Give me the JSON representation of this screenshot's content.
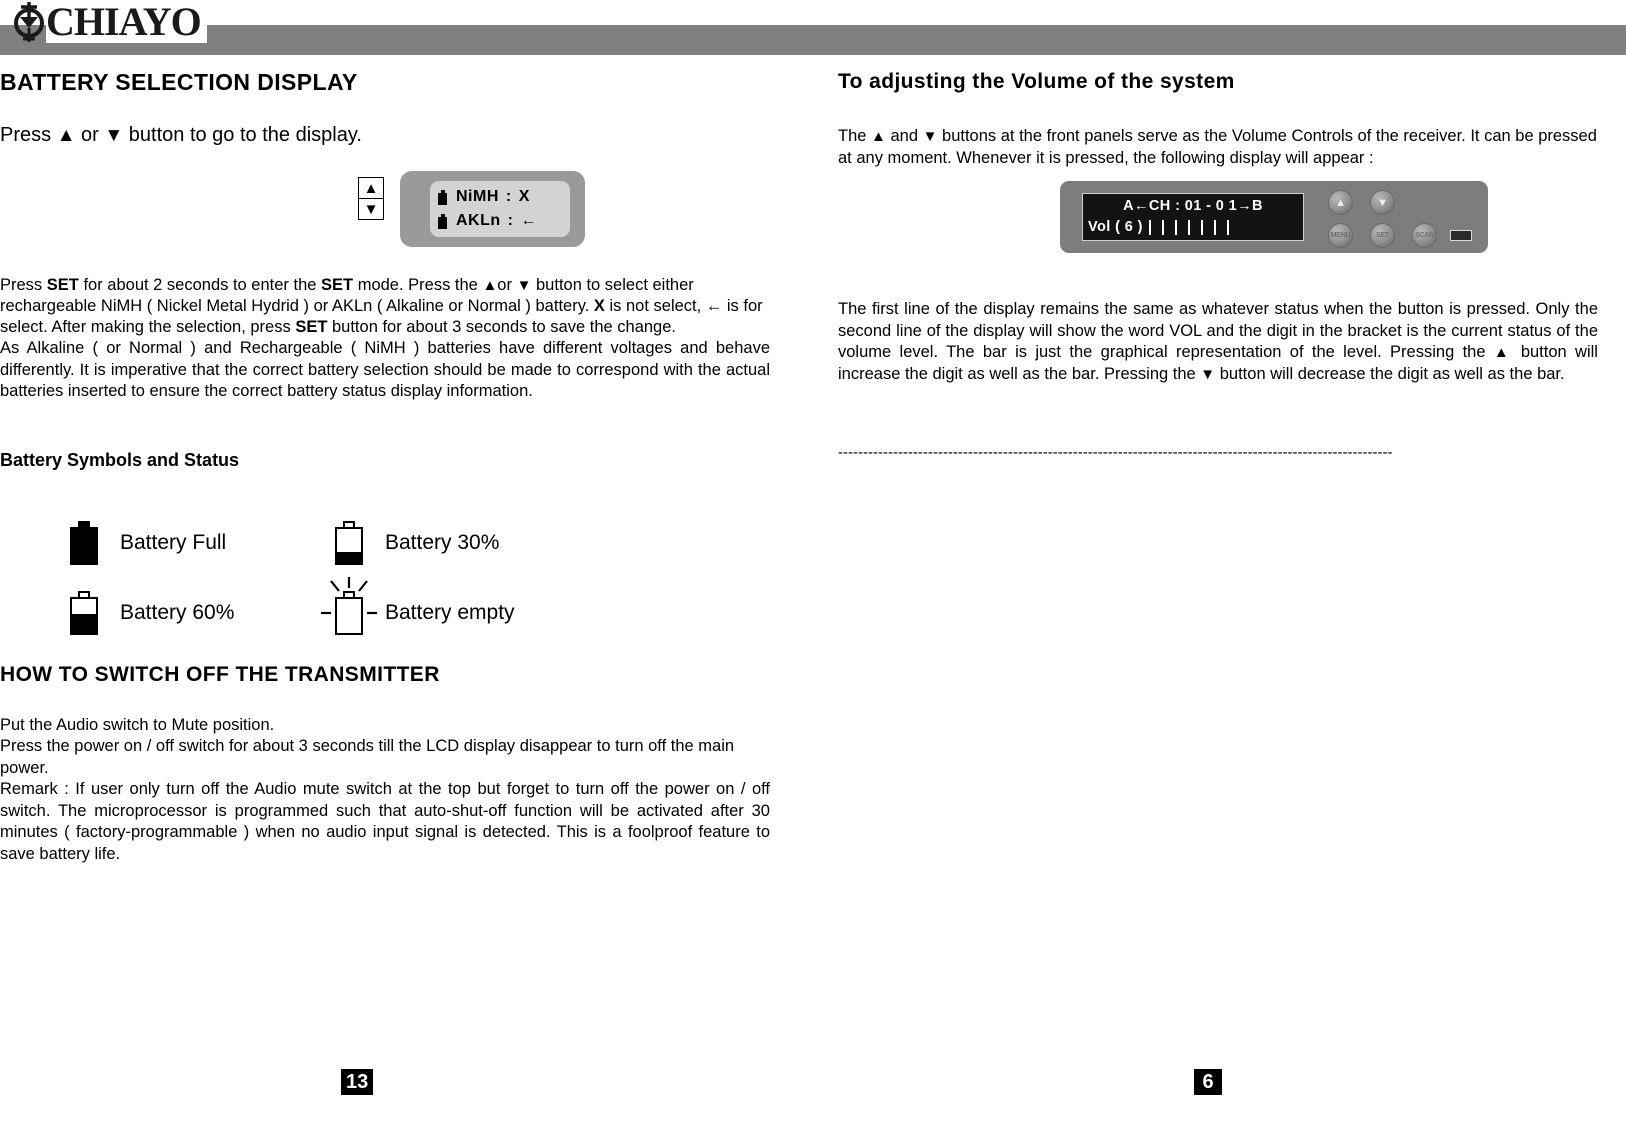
{
  "brand": {
    "name": "CHIAYO",
    "logo_icon": "chiayo-emblem-icon"
  },
  "left_column": {
    "title": "BATTERY SELECTION DISPLAY",
    "intro_pre": "Press ",
    "intro_mid": " or ",
    "intro_post": " button to go to the display.",
    "lcd": {
      "line1_label": "NiMH",
      "line1_sep": ":",
      "line1_value": "X",
      "line2_label": "AKLn",
      "line2_sep": ":",
      "line2_value": "←",
      "up_key": "▲",
      "down_key": "▼"
    },
    "para1": {
      "s1": "Press ",
      "b1": "SET",
      "s2": " for about 2 seconds to enter the ",
      "b2": "SET",
      "s3": " mode. Press the ",
      "s4": "or ",
      "s5": " button to select either rechargeable NiMH ( Nickel Metal Hydrid ) or AKLn ( Alkaline or Normal ) battery.  ",
      "b3": "X",
      "s6": " is not select, ← is for select. After making the selection, press ",
      "b4": "SET",
      "s7": " button for about 3 seconds to save the change."
    },
    "para2": "As Alkaline ( or Normal ) and Rechargeable ( NiMH ) batteries have different voltages and behave differently. It is imperative that the correct battery selection should be made to correspond with the actual batteries inserted to ensure the correct battery status display information.",
    "legend_title": "Battery Symbols and Status",
    "legend": [
      {
        "icon": "battery-full-icon",
        "label": "Battery Full",
        "fill_percent": 100
      },
      {
        "icon": "battery-30-icon",
        "label": "Battery 30%",
        "fill_percent": 30
      },
      {
        "icon": "battery-60-icon",
        "label": "Battery 60%",
        "fill_percent": 60
      },
      {
        "icon": "battery-empty-icon",
        "label": "Battery empty",
        "fill_percent": 0
      }
    ],
    "switch_off_title": "HOW TO SWITCH OFF THE TRANSMITTER",
    "switch_off_line1": "Put the Audio switch to Mute position.",
    "switch_off_line2": "Press the power on / off switch for about 3 seconds till the LCD display disappear to turn off the main power.",
    "switch_off_line3": "Remark : If user only turn off the Audio mute switch at the top but forget to turn off the power on / off switch. The microprocessor is programmed such that auto-shut-off function will be activated after 30 minutes ( factory-programmable ) when no audio input signal is detected. This is a foolproof feature to save battery life.",
    "page_number": "13"
  },
  "right_column": {
    "title": "To adjusting the Volume of the system",
    "para1": {
      "s1": "The ",
      "s2": " and ",
      "s3": " buttons at the front panels serve as the Volume Controls of the receiver. It can be pressed at any moment. Whenever it is pressed, the following display will appear :"
    },
    "panel": {
      "lcd_line1": "A←CH : 01 - 0 1→B",
      "lcd_line2_label": "Vol ( 6 )",
      "vol_bar_count": 7,
      "buttons": [
        {
          "name": "panel-up-button",
          "label": "▲"
        },
        {
          "name": "panel-down-button",
          "label": "▼"
        },
        {
          "name": "panel-menu-button",
          "label": "MENU"
        },
        {
          "name": "panel-set-button",
          "label": "SET"
        },
        {
          "name": "panel-scan-button",
          "label": "SCAN"
        }
      ],
      "led_indicator": "power-led-indicator"
    },
    "para2": {
      "s1": "The first line of the display remains the same as whatever status when the button is pressed. Only the second line of the display will show the word VOL and the digit in the bracket is the current status of the volume level. The bar is just the graphical representation of the level. Pressing the ",
      "s2": " button will increase the digit as well as the bar. Pressing the ",
      "s3": " button will decrease the digit as well as the bar."
    },
    "separator": "---------------------------------------------------------------------------------------------------------------",
    "page_number": "6"
  },
  "glyphs": {
    "triangle_up": "▲",
    "triangle_down": "▼",
    "arrow_left": "←"
  }
}
